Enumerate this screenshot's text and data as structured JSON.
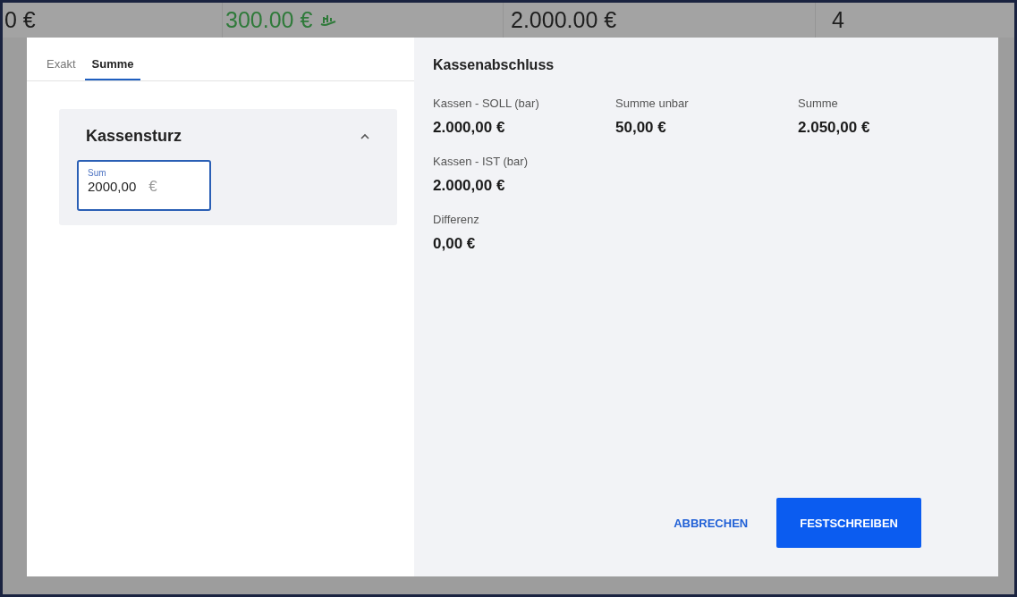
{
  "background_row": [
    {
      "text": "0 €",
      "color": "#1e1e1e",
      "icon": false
    },
    {
      "text": "300.00 €",
      "color": "#2f7a3a",
      "icon": true
    },
    {
      "text": "2.000.00 €",
      "color": "#1e1e1e",
      "icon": false
    },
    {
      "text": "4",
      "color": "#1e1e1e",
      "icon": false
    }
  ],
  "dialog": {
    "tabs": [
      {
        "label": "Exakt",
        "selected": false
      },
      {
        "label": "Summe",
        "selected": true
      }
    ],
    "card": {
      "title": "Kassensturz",
      "expanded": true,
      "field": {
        "label": "Sum",
        "value": "2000,00",
        "suffix": "€",
        "focused": true
      }
    },
    "summary": {
      "title": "Kassenabschluss",
      "rows": [
        [
          {
            "label": "Kassen - SOLL (bar)",
            "value": "2.000,00 €"
          },
          {
            "label": "Summe unbar",
            "value": "50,00 €"
          },
          {
            "label": "Summe",
            "value": "2.050,00 €"
          }
        ],
        [
          {
            "label": "Kassen - IST (bar)",
            "value": "2.000,00 €"
          }
        ],
        [
          {
            "label": "Differenz",
            "value": "0,00 €"
          }
        ]
      ]
    },
    "buttons": [
      {
        "label": "ABBRECHEN",
        "kind": "text"
      },
      {
        "label": "FESTSCHREIBEN",
        "kind": "primary"
      }
    ]
  }
}
